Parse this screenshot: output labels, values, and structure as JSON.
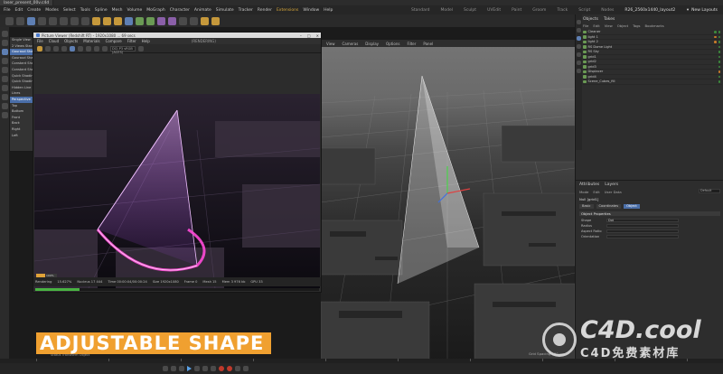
{
  "app": {
    "tabs": [
      "laser_present_00v.c4d",
      "",
      ""
    ],
    "menu": [
      "File",
      "Edit",
      "Create",
      "Modes",
      "Select",
      "Tools",
      "Spline",
      "Mesh",
      "Volume",
      "MoGraph",
      "Character",
      "Animate",
      "Simulate",
      "Tracker",
      "Render"
    ],
    "extensions_label": "Extensions",
    "window_label": "Window",
    "help_label": "Help",
    "layouts": [
      "Standard",
      "Model",
      "Sculpt",
      "UVEdit",
      "Paint",
      "Groom",
      "Track",
      "Script",
      "Nodes"
    ],
    "layout_active": "R26_2560x1440_layout2",
    "new_layouts": "New Layouts"
  },
  "display_menu": {
    "items": [
      "Single View",
      "2 Views Stacked",
      "Gouraud Shading",
      "Gouraud Shading (Lines)",
      "Constant Shading",
      "Constant Shading (Lines)",
      "Quick Shading",
      "Quick Shading (Lines)",
      "Hidden Line",
      "Lines",
      "Perspective",
      "Top",
      "Bottom",
      "Front",
      "Back",
      "Right",
      "Left"
    ],
    "highlight_index": 10
  },
  "picture_viewer": {
    "title": "Picture Viewer (Redshift RT) - 1920x1080 ... 69 secs",
    "menu": [
      "File",
      "Cloud",
      "Objects",
      "Materials",
      "Compare",
      "Filter",
      "Help"
    ],
    "rendering_label": "(RENDERING)",
    "view_select": "DCI-P3 sRGB (ACES)",
    "zoom": "100%",
    "status": {
      "state": "Rendering",
      "percent": "15.627%",
      "renderer": "Nucleus 17 444",
      "time": "Time 00:00:04/00:00:24",
      "size": "Size 1920x1080",
      "frame": "Frame 0",
      "mesh": "Mesh 15",
      "memory": "Mem 3 976 kb",
      "gpu": "GPU 33"
    },
    "progress": 0.156
  },
  "viewport": {
    "menu": [
      "View",
      "Cameras",
      "Display",
      "Options",
      "Filter",
      "Panel"
    ],
    "grid_spacing": "Grid Spacing : 50 cm"
  },
  "objects": {
    "tabs": [
      "Objects",
      "Takes"
    ],
    "menu": [
      "File",
      "Edit",
      "View",
      "Object",
      "Tags",
      "Bookmarks"
    ],
    "items": [
      "Cleaner",
      "light 1",
      "light 2",
      "RS Dome Light",
      "RS Sky",
      "grid1",
      "grid2",
      "grid3",
      "Displacer",
      "grid4",
      "Scene_Cubes_fill"
    ]
  },
  "attributes": {
    "tabs": [
      "Attributes",
      "Layers"
    ],
    "menu": [
      "Mode",
      "Edit",
      "User Data"
    ],
    "mode_select": "Default",
    "object_name": "Null [grid1]",
    "subtabs": [
      "Basic",
      "Coordinates",
      "Object"
    ],
    "subtab_active": 2,
    "section": "Object Properties",
    "props": [
      {
        "label": "Shape",
        "value": "Dot"
      },
      {
        "label": "Radius",
        "value": ""
      },
      {
        "label": "Aspect Ratio",
        "value": ""
      },
      {
        "label": "Orientation",
        "value": ""
      }
    ]
  },
  "status_bar": "Status Transform Object",
  "timeline_grid": "Grid Spacing : 50 cm",
  "caption": "ADJUSTABLE SHAPE",
  "watermark": {
    "title": "C4D.cool",
    "subtitle": "C4D免费素材库"
  }
}
